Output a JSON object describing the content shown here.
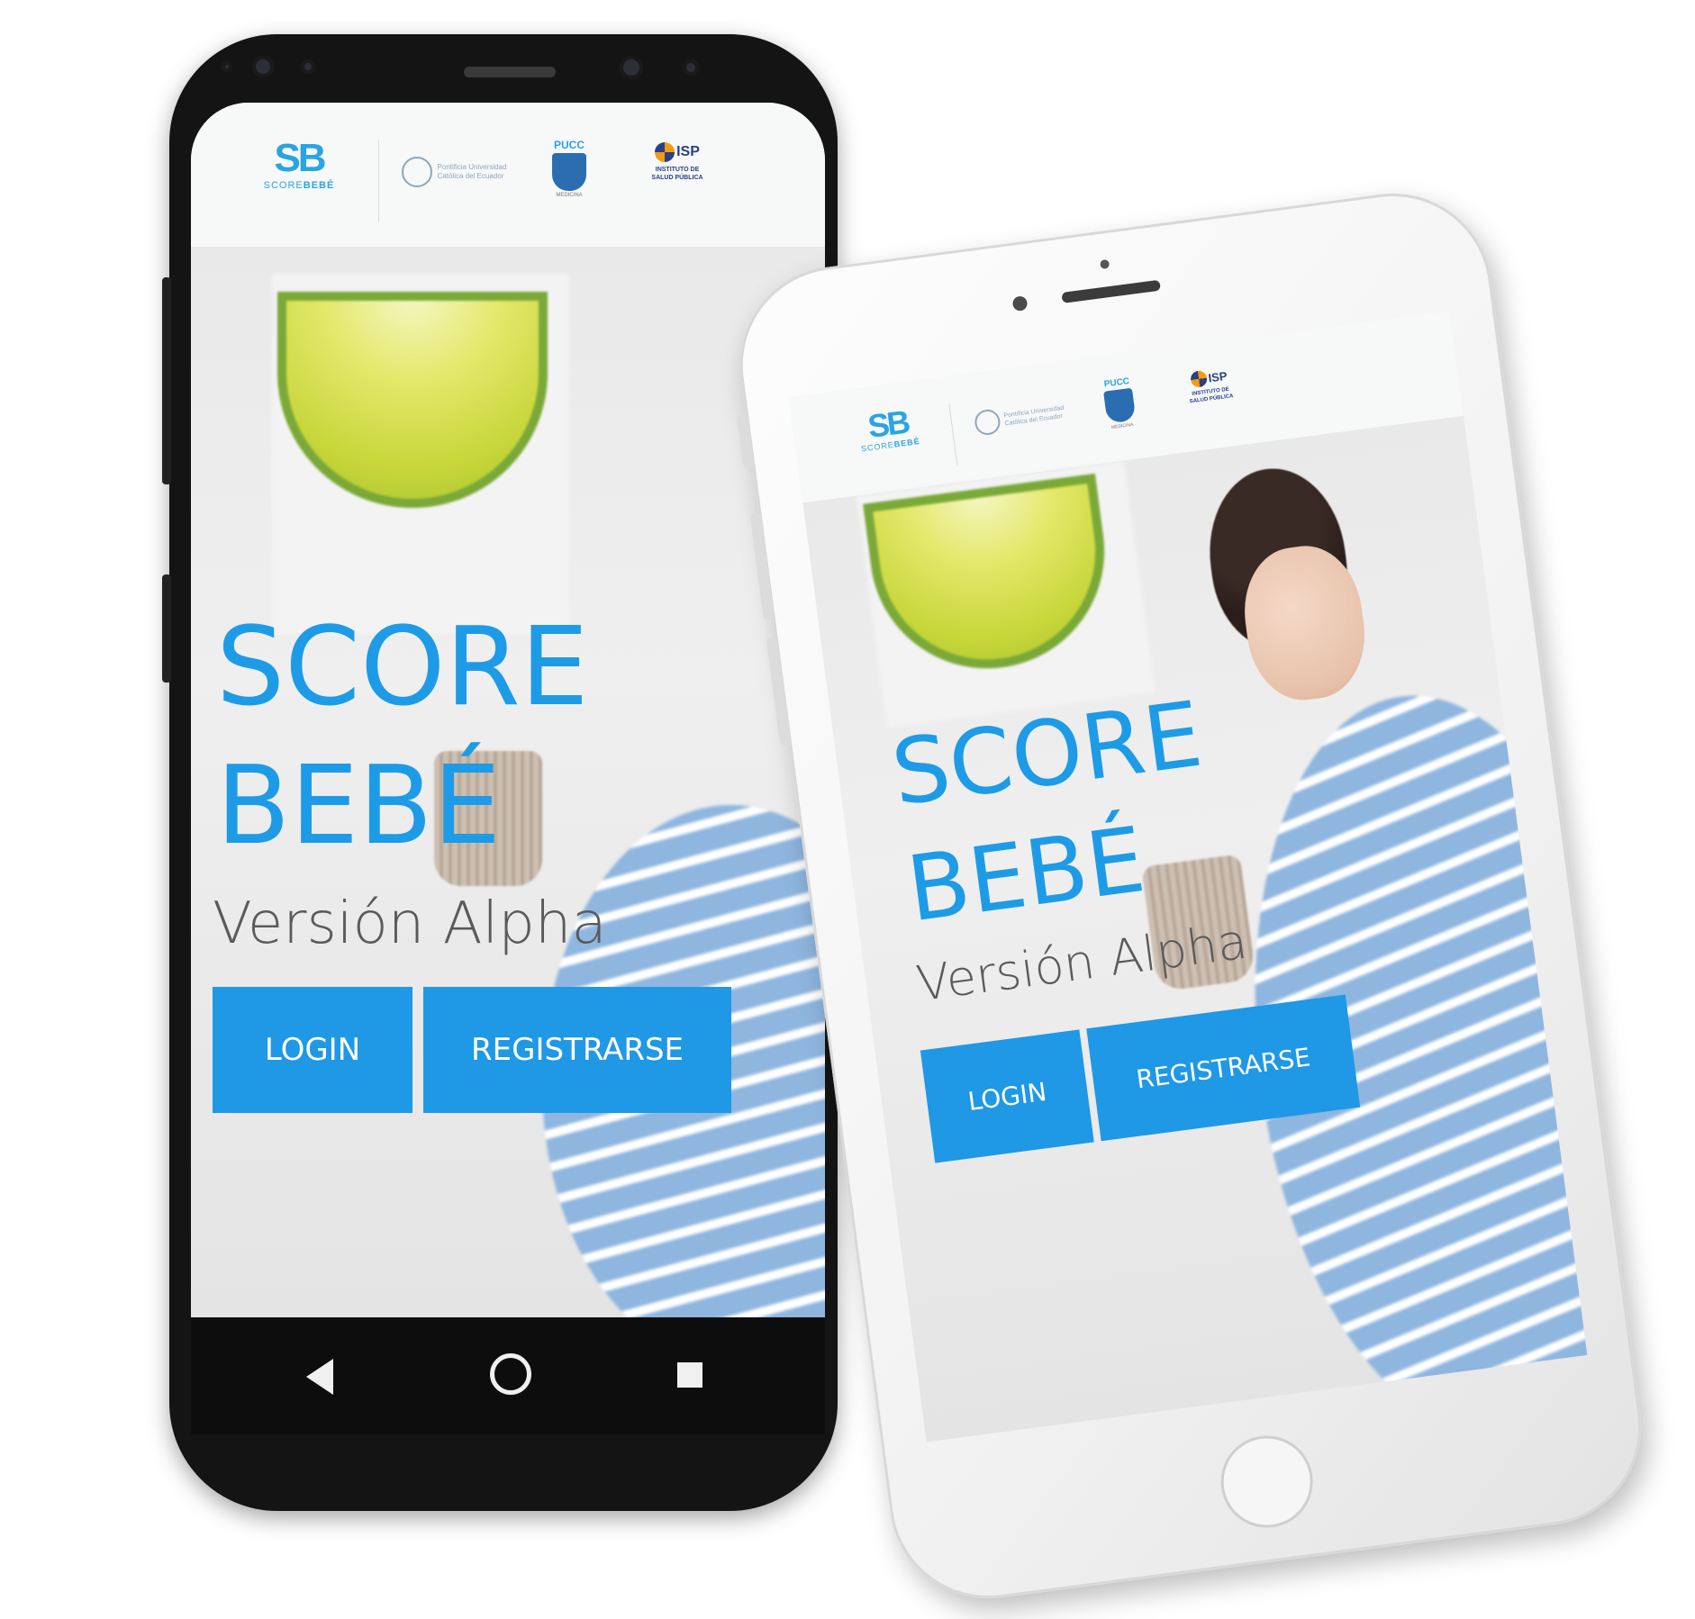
{
  "app": {
    "title_line1": "SCORE",
    "title_line2": "BEBÉ",
    "subtitle": "Versión Alpha",
    "login_label": "LOGIN",
    "register_label": "REGISTRARSE",
    "accent_color": "#1f98e6"
  },
  "header_logos": {
    "scorebebe": {
      "mark": "SB",
      "word_a": "SCORE",
      "word_b": "BEBÉ"
    },
    "pucem": {
      "line1": "Pontificia Universidad",
      "line2": "Católica del Ecuador"
    },
    "pucc": {
      "label": "PUCC",
      "ribbon": "MEDICINA"
    },
    "isp": {
      "mark": "ISP",
      "line1": "INSTITUTO DE",
      "line2": "SALUD PÚBLICA"
    }
  },
  "navbar": {
    "back_icon": "back-triangle-icon",
    "home_icon": "home-circle-icon",
    "recents_icon": "recents-square-icon"
  }
}
